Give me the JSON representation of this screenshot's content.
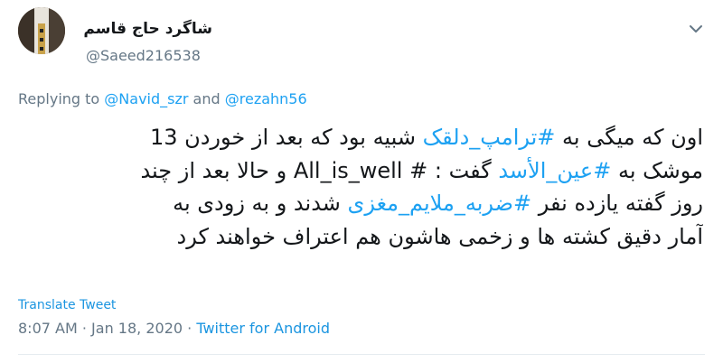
{
  "author": {
    "display_name": "شاگرد حاج قاسم",
    "handle": "@Saeed216538"
  },
  "reply": {
    "prefix": "Replying to",
    "user1": "@Navid_szr",
    "conjunction": "and",
    "user2": "@rezahn56"
  },
  "tweet": {
    "line1": {
      "t1": "اون که میگی به ",
      "h1": "#ترامپ_دلقک",
      "t2": " شبیه بود که بعد از خوردن 13"
    },
    "line2": {
      "t1": "موشک به ",
      "h1": "#عین_الأسد",
      "t2": " گفت : ",
      "en": "All_is_well #",
      "t3": " و حالا بعد از چند"
    },
    "line3": {
      "t1": "روز گفته یازده نفر ",
      "h1": "#ضربه_ملایم_مغزی",
      "t2": " شدند و به زودی به"
    },
    "line4": {
      "t1": "آمار دقیق کشته ها و زخمی هاشون هم اعتراف خواهند کرد"
    }
  },
  "translate_label": "Translate Tweet",
  "meta": {
    "time": "8:07 AM",
    "separator1": "·",
    "date": "Jan 18, 2020",
    "separator2": "·",
    "source": "Twitter for Android"
  },
  "icons": {
    "avatar": "avatar-photo",
    "menu": "chevron-down-icon"
  },
  "colors": {
    "link": "#1da1f2",
    "secondary_text": "#657786",
    "primary_text": "#14171a"
  }
}
